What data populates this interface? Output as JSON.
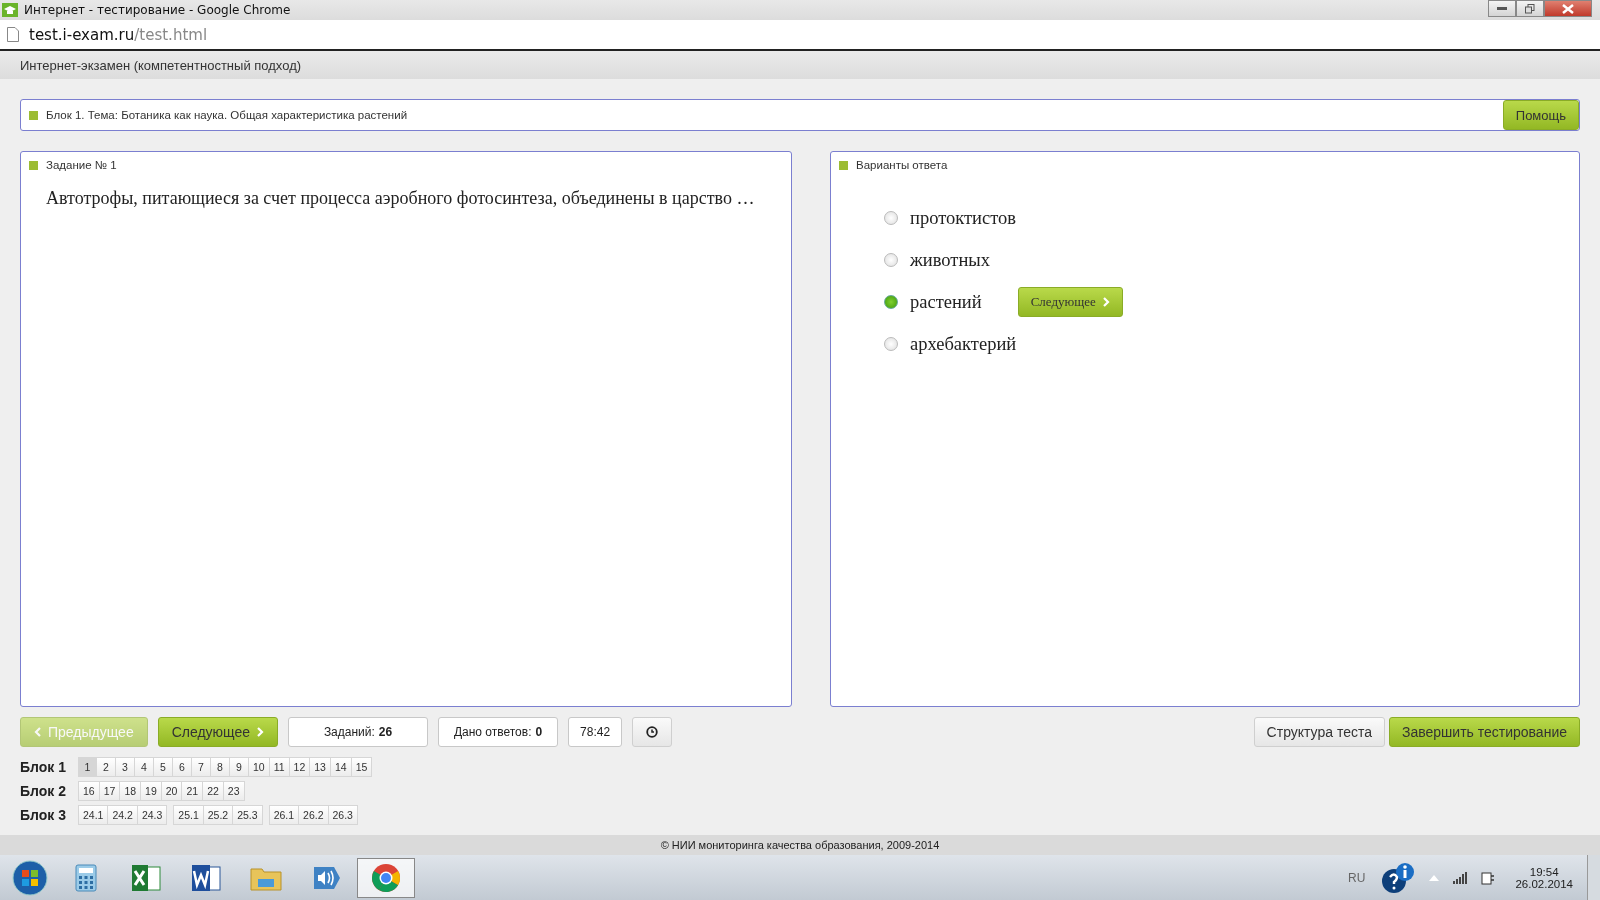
{
  "window": {
    "title": "Интернет - тестирование - Google Chrome"
  },
  "address_bar": {
    "host": "test.i-exam.ru",
    "path": "/test.html"
  },
  "app_header": {
    "title": "Интернет-экзамен (компетентностный подход)"
  },
  "block_bar": {
    "title": "Блок 1. Тема: Ботаника как наука. Общая характеристика растений",
    "help_button": "Помощь"
  },
  "question_panel": {
    "title": "Задание № 1",
    "text": "Автотрофы, питающиеся за счет процесса аэробного фотосинтеза, объединены в царство …"
  },
  "answers_panel": {
    "title": "Варианты ответа",
    "next_button": "Следующее",
    "options": [
      {
        "label": "протоктистов",
        "selected": false
      },
      {
        "label": "животных",
        "selected": false
      },
      {
        "label": "растений",
        "selected": true
      },
      {
        "label": "архебактерий",
        "selected": false
      }
    ]
  },
  "toolbar": {
    "prev_button": {
      "label": "Предыдущее",
      "disabled": true
    },
    "next_button": {
      "label": "Следующее",
      "disabled": false
    },
    "tasks": {
      "label": "Заданий:",
      "value": "26"
    },
    "answered": {
      "label": "Дано ответов:",
      "value": "0"
    },
    "timer": "78:42",
    "structure_button": "Структура теста",
    "finish_button": "Завершить тестирование"
  },
  "blocks": [
    {
      "label": "Блок 1",
      "groups": [
        [
          {
            "label": "1",
            "selected": true
          },
          {
            "label": "2",
            "selected": false
          },
          {
            "label": "3",
            "selected": false
          },
          {
            "label": "4",
            "selected": false
          },
          {
            "label": "5",
            "selected": false
          },
          {
            "label": "6",
            "selected": false
          },
          {
            "label": "7",
            "selected": false
          },
          {
            "label": "8",
            "selected": false
          },
          {
            "label": "9",
            "selected": false
          },
          {
            "label": "10",
            "selected": false
          },
          {
            "label": "11",
            "selected": false
          },
          {
            "label": "12",
            "selected": false
          },
          {
            "label": "13",
            "selected": false
          },
          {
            "label": "14",
            "selected": false
          },
          {
            "label": "15",
            "selected": false
          }
        ]
      ]
    },
    {
      "label": "Блок 2",
      "groups": [
        [
          {
            "label": "16",
            "selected": false
          },
          {
            "label": "17",
            "selected": false
          },
          {
            "label": "18",
            "selected": false
          },
          {
            "label": "19",
            "selected": false
          },
          {
            "label": "20",
            "selected": false
          },
          {
            "label": "21",
            "selected": false
          },
          {
            "label": "22",
            "selected": false
          },
          {
            "label": "23",
            "selected": false
          }
        ]
      ]
    },
    {
      "label": "Блок 3",
      "groups": [
        [
          {
            "label": "24.1",
            "selected": false
          },
          {
            "label": "24.2",
            "selected": false
          },
          {
            "label": "24.3",
            "selected": false
          }
        ],
        [
          {
            "label": "25.1",
            "selected": false
          },
          {
            "label": "25.2",
            "selected": false
          },
          {
            "label": "25.3",
            "selected": false
          }
        ],
        [
          {
            "label": "26.1",
            "selected": false
          },
          {
            "label": "26.2",
            "selected": false
          },
          {
            "label": "26.3",
            "selected": false
          }
        ]
      ]
    }
  ],
  "footer": "© НИИ мониторинга качества образования, 2009-2014",
  "taskbar": {
    "apps": [
      {
        "kind": "calculator",
        "selected": false
      },
      {
        "kind": "excel",
        "selected": false
      },
      {
        "kind": "word",
        "selected": false
      },
      {
        "kind": "folder",
        "selected": false
      },
      {
        "kind": "speaker",
        "selected": false
      },
      {
        "kind": "chrome",
        "selected": true
      }
    ],
    "language": "RU",
    "time": "19:54",
    "date": "26.02.2014"
  }
}
